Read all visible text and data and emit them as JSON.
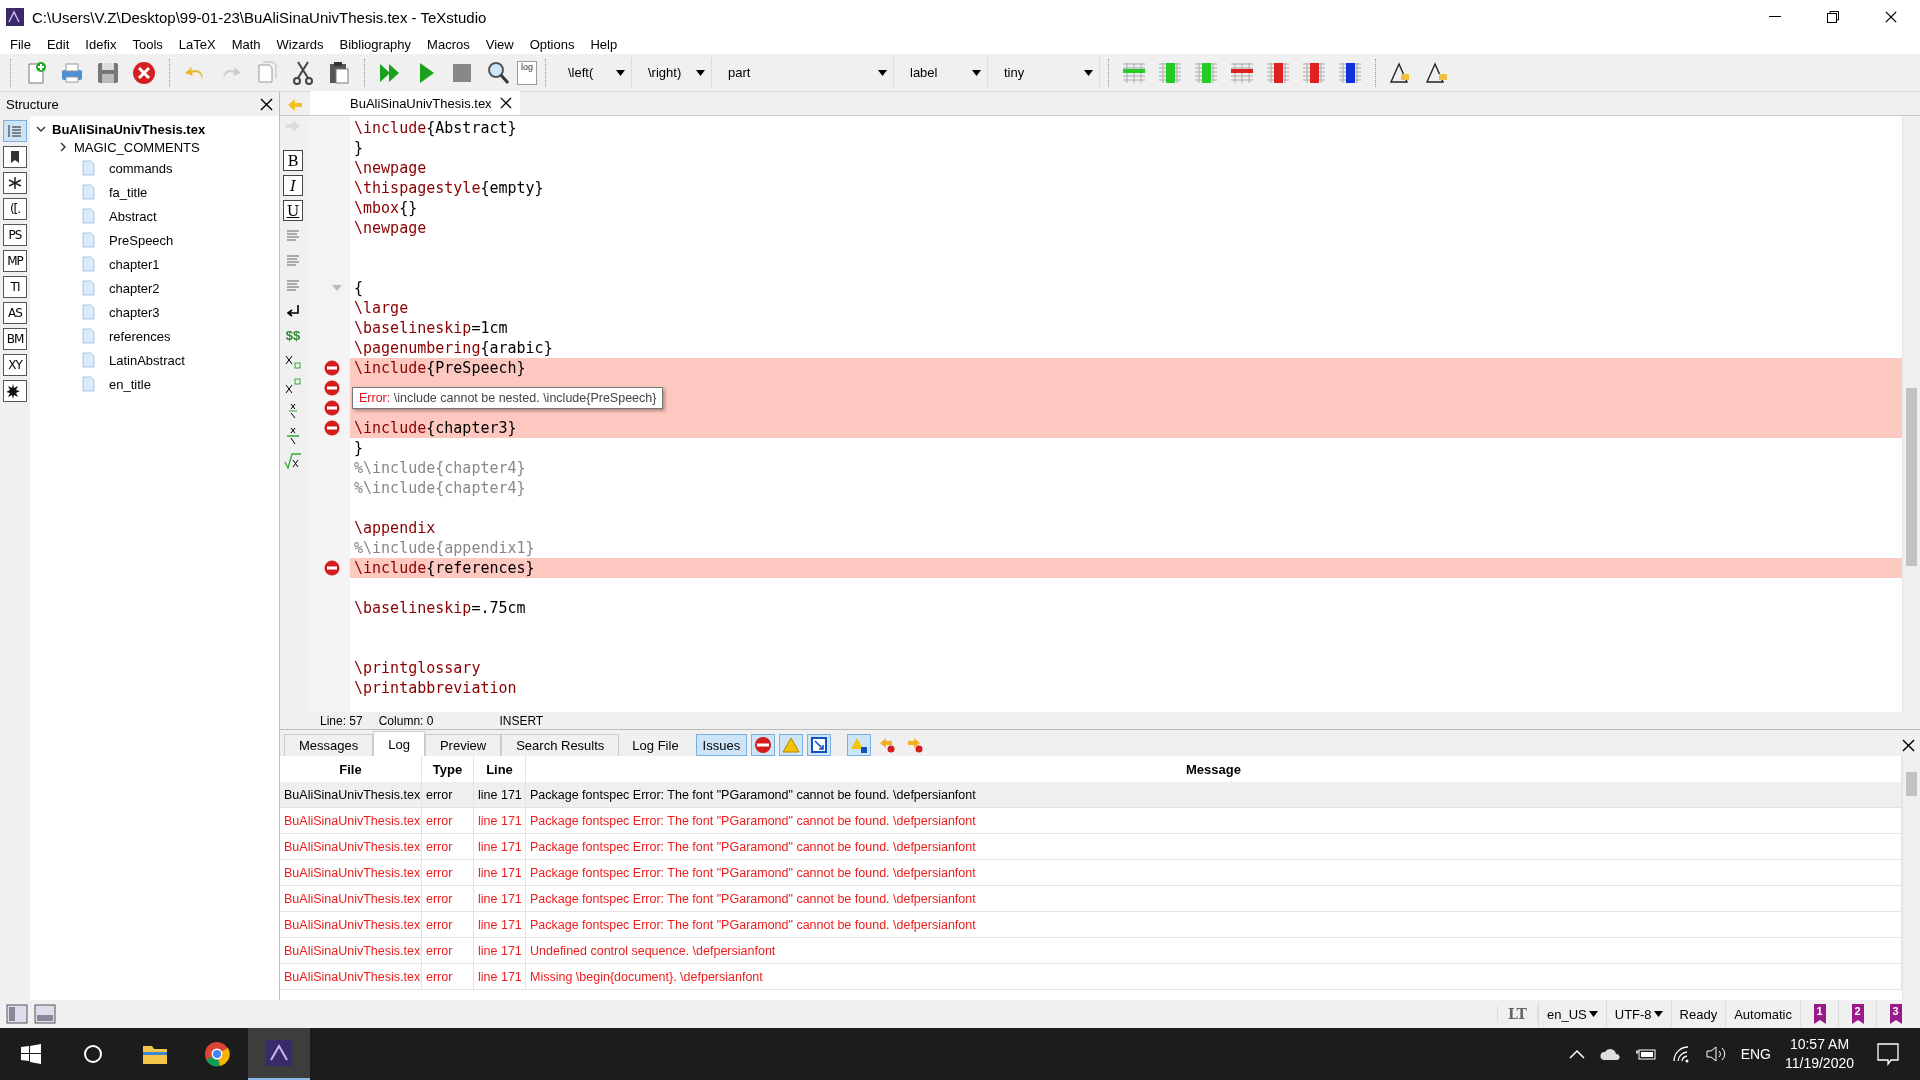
{
  "window": {
    "title": "C:\\Users\\V.Z\\Desktop\\99-01-23\\BuAliSinaUnivThesis.tex - TeXstudio"
  },
  "menu": [
    "File",
    "Edit",
    "Idefix",
    "Tools",
    "LaTeX",
    "Math",
    "Wizards",
    "Bibliography",
    "Macros",
    "View",
    "Options",
    "Help"
  ],
  "toolbar": {
    "log_label": "log",
    "dropdowns": [
      "\\left(",
      "\\right)",
      "part",
      "label",
      "tiny"
    ]
  },
  "structure": {
    "title": "Structure",
    "tools": [
      {
        "kind": "list",
        "selected": true
      },
      {
        "kind": "bookmark",
        "selected": false
      },
      {
        "kind": "asterisk",
        "selected": false
      },
      {
        "kind": "label",
        "label": "([.",
        "selected": false
      },
      {
        "kind": "label",
        "label": "PS",
        "selected": false
      },
      {
        "kind": "label",
        "label": "MP",
        "selected": false
      },
      {
        "kind": "label",
        "label": "TI",
        "selected": false
      },
      {
        "kind": "label",
        "label": "AS",
        "selected": false
      },
      {
        "kind": "label",
        "label": "BM",
        "selected": false
      },
      {
        "kind": "label",
        "label": "XY",
        "selected": false
      },
      {
        "kind": "burst",
        "selected": false
      }
    ],
    "root": {
      "label": "BuAliSinaUnivThesis.tex",
      "expanded": true,
      "children": [
        {
          "label": "MAGIC_COMMENTS",
          "kind": "group",
          "expanded": false
        },
        {
          "label": "commands",
          "kind": "file"
        },
        {
          "label": "fa_title",
          "kind": "file"
        },
        {
          "label": "Abstract",
          "kind": "file"
        },
        {
          "label": "PreSpeech",
          "kind": "file"
        },
        {
          "label": "chapter1",
          "kind": "file"
        },
        {
          "label": "chapter2",
          "kind": "file"
        },
        {
          "label": "chapter3",
          "kind": "file"
        },
        {
          "label": "references",
          "kind": "file"
        },
        {
          "label": "LatinAbstract",
          "kind": "file"
        },
        {
          "label": "en_title",
          "kind": "file"
        }
      ]
    }
  },
  "editor": {
    "tab": "BuAliSinaUnivThesis.tex",
    "format_buttons": [
      "B",
      "I",
      "U"
    ],
    "math_label": "$$",
    "lines": [
      {
        "kind": "code",
        "text": "\\include{Abstract}",
        "error": false
      },
      {
        "kind": "code",
        "text": "}",
        "error": false
      },
      {
        "kind": "code",
        "text": "\\newpage",
        "error": false
      },
      {
        "kind": "code",
        "text": "\\thispagestyle{empty}",
        "error": false
      },
      {
        "kind": "code",
        "text": "\\mbox{}",
        "error": false
      },
      {
        "kind": "code",
        "text": "\\newpage",
        "error": false
      },
      {
        "kind": "blank",
        "error": false
      },
      {
        "kind": "blank",
        "error": false
      },
      {
        "kind": "code",
        "text": "{",
        "error": false,
        "fold": true
      },
      {
        "kind": "code",
        "text": "\\large",
        "error": false
      },
      {
        "kind": "code",
        "text": "\\baselineskip=1cm",
        "error": false
      },
      {
        "kind": "code",
        "text": "\\pagenumbering{arabic}",
        "error": false
      },
      {
        "kind": "code",
        "text": "\\include{PreSpeech}",
        "error": true
      },
      {
        "kind": "blank",
        "error": true
      },
      {
        "kind": "blank",
        "error": true
      },
      {
        "kind": "code",
        "text": "\\include{chapter3}",
        "error": true
      },
      {
        "kind": "code",
        "text": "}",
        "error": false
      },
      {
        "kind": "comment",
        "text": "%\\include{chapter4}",
        "error": false
      },
      {
        "kind": "comment",
        "text": "%\\include{chapter4}",
        "error": false
      },
      {
        "kind": "blank",
        "error": false
      },
      {
        "kind": "code",
        "text": "\\appendix",
        "error": false
      },
      {
        "kind": "comment",
        "text": "%\\include{appendix1}",
        "error": false
      },
      {
        "kind": "code",
        "text": "\\include{references}",
        "error": true
      },
      {
        "kind": "blank",
        "error": false
      },
      {
        "kind": "code",
        "text": "\\baselineskip=.75cm",
        "error": false
      },
      {
        "kind": "blank",
        "error": false
      },
      {
        "kind": "blank",
        "error": false
      },
      {
        "kind": "code",
        "text": "\\printglossary",
        "error": false
      },
      {
        "kind": "code",
        "text": "\\printabbreviation",
        "error": false
      }
    ],
    "tooltip": {
      "label": "Error:",
      "text": "\\include cannot be nested. \\include{PreSpeech}"
    }
  },
  "cursor_status": {
    "line": "Line: 57",
    "column": "Column: 0",
    "mode": "INSERT"
  },
  "bottom": {
    "tabs": [
      {
        "label": "Messages",
        "selected": false
      },
      {
        "label": "Log",
        "selected": true
      },
      {
        "label": "Preview",
        "selected": false
      },
      {
        "label": "Search Results",
        "selected": false
      }
    ],
    "log_file": "Log File",
    "issues": {
      "label": "Issues",
      "selected": true
    },
    "table": {
      "columns": [
        "File",
        "Type",
        "Line",
        "Message"
      ],
      "rows": [
        {
          "file": "BuAliSinaUnivThesis.tex",
          "type": "error",
          "line": "line 171",
          "message": "Package fontspec Error: The font \"PGaramond\" cannot be found. \\defpersianfont",
          "selected": true
        },
        {
          "file": "BuAliSinaUnivThesis.tex",
          "type": "error",
          "line": "line 171",
          "message": "Package fontspec Error: The font \"PGaramond\" cannot be found. \\defpersianfont",
          "selected": false
        },
        {
          "file": "BuAliSinaUnivThesis.tex",
          "type": "error",
          "line": "line 171",
          "message": "Package fontspec Error: The font \"PGaramond\" cannot be found. \\defpersianfont",
          "selected": false
        },
        {
          "file": "BuAliSinaUnivThesis.tex",
          "type": "error",
          "line": "line 171",
          "message": "Package fontspec Error: The font \"PGaramond\" cannot be found. \\defpersianfont",
          "selected": false
        },
        {
          "file": "BuAliSinaUnivThesis.tex",
          "type": "error",
          "line": "line 171",
          "message": "Package fontspec Error: The font \"PGaramond\" cannot be found. \\defpersianfont",
          "selected": false
        },
        {
          "file": "BuAliSinaUnivThesis.tex",
          "type": "error",
          "line": "line 171",
          "message": "Package fontspec Error: The font \"PGaramond\" cannot be found. \\defpersianfont",
          "selected": false
        },
        {
          "file": "BuAliSinaUnivThesis.tex",
          "type": "error",
          "line": "line 171",
          "message": "Undefined control sequence. \\defpersianfont",
          "selected": false
        },
        {
          "file": "BuAliSinaUnivThesis.tex",
          "type": "error",
          "line": "line 171",
          "message": "Missing \\begin{document}. \\defpersianfont",
          "selected": false
        }
      ]
    }
  },
  "status_bar": {
    "lt": "LT",
    "language": "en_US",
    "encoding": "UTF-8",
    "state": "Ready",
    "mode": "Automatic",
    "bookmarks": [
      "1",
      "2",
      "3"
    ]
  },
  "taskbar": {
    "language": "ENG",
    "time": "10:57 AM",
    "date": "11/19/2020"
  }
}
